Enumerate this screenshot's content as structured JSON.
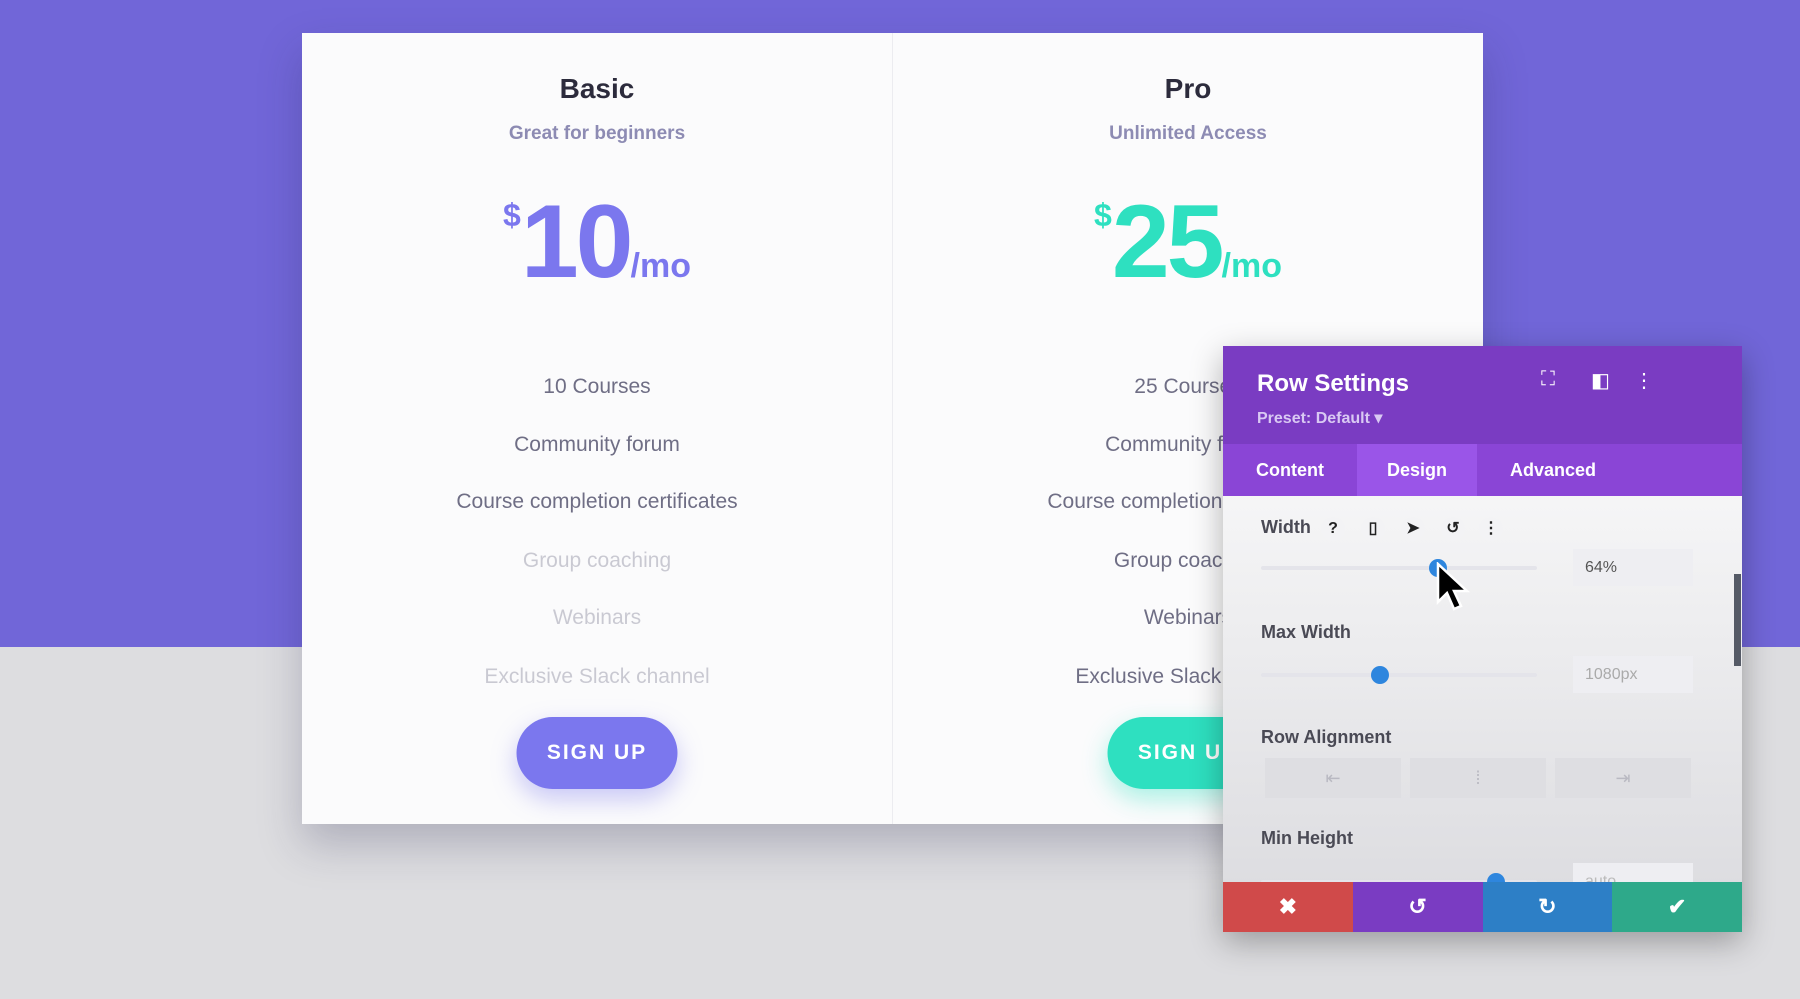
{
  "plans": [
    {
      "title": "Basic",
      "subtitle": "Great for beginners",
      "currency": "$",
      "amount": "10",
      "period": "/mo",
      "color": "#7b77ee",
      "features": [
        "10 Courses",
        "Community forum",
        "Course completion certificates",
        "Group coaching",
        "Webinars",
        "Exclusive Slack channel"
      ],
      "feature_enabled": [
        true,
        true,
        true,
        false,
        false,
        false
      ],
      "button": "SIGN UP"
    },
    {
      "title": "Pro",
      "subtitle": "Unlimited Access",
      "currency": "$",
      "amount": "25",
      "period": "/mo",
      "color": "#2ee0c0",
      "features": [
        "25 Courses",
        "Community forum",
        "Course completion certificates",
        "Group coaching",
        "Webinars",
        "Exclusive Slack channel"
      ],
      "feature_enabled": [
        true,
        true,
        true,
        true,
        true,
        true
      ],
      "button": "SIGN UP"
    }
  ],
  "panel": {
    "title": "Row Settings",
    "preset": "Preset: Default ▾",
    "tabs": [
      "Content",
      "Design",
      "Advanced"
    ],
    "active_tab": "Design",
    "width": {
      "label": "Width",
      "value": "64%",
      "level": 0.64
    },
    "max_width": {
      "label": "Max Width",
      "value": "1080px",
      "level": 0.43
    },
    "row_alignment": {
      "label": "Row Alignment",
      "options": [
        "⇤",
        "⁞",
        "⇥"
      ]
    },
    "min_height": {
      "label": "Min Height",
      "value": "auto",
      "level": 0.85
    },
    "footer": {
      "cancel": "✖",
      "undo": "↺",
      "redo": "↻",
      "save": "✔"
    }
  }
}
